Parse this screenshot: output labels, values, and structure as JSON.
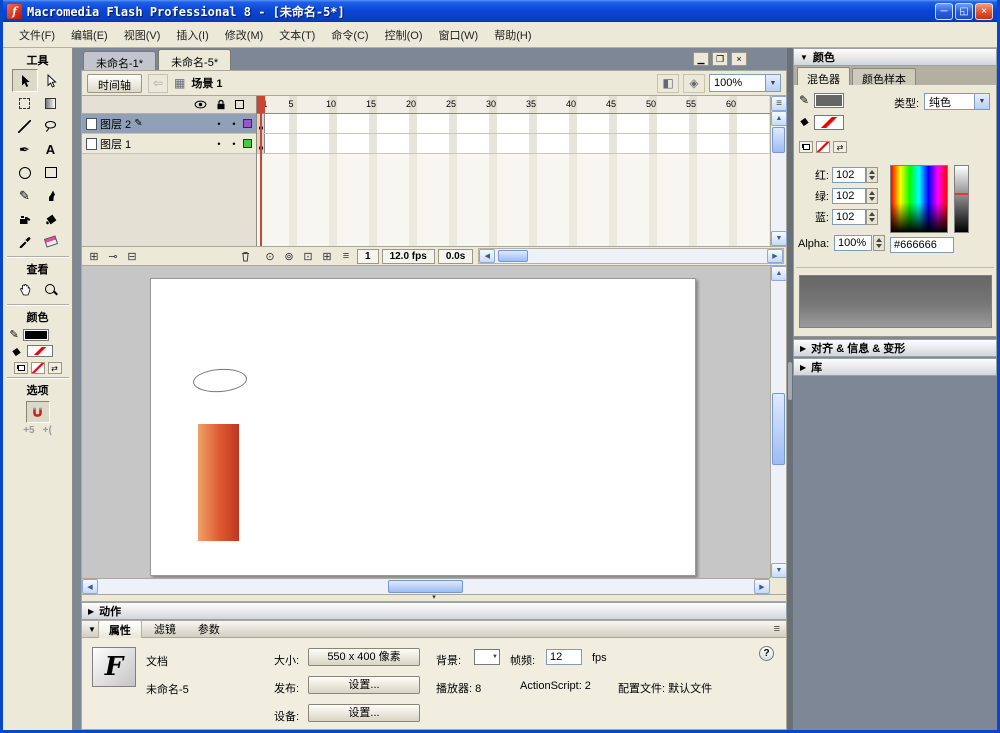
{
  "titlebar": {
    "title": "Macromedia Flash Professional 8 - [未命名-5*]"
  },
  "menu": {
    "items": [
      "文件(F)",
      "编辑(E)",
      "视图(V)",
      "插入(I)",
      "修改(M)",
      "文本(T)",
      "命令(C)",
      "控制(O)",
      "窗口(W)",
      "帮助(H)"
    ]
  },
  "toolbox": {
    "tools_label": "工具",
    "view_label": "查看",
    "colors_label": "颜色",
    "options_label": "选项"
  },
  "doc_tabs": [
    {
      "label": "未命名-1*",
      "active": false
    },
    {
      "label": "未命名-5*",
      "active": true
    }
  ],
  "timeline": {
    "panel_button": "时间轴",
    "scene_name": "场景 1",
    "zoom_value": "100%",
    "layers": [
      {
        "name": "图层 2",
        "selected": true,
        "outline_color": "#9954cc"
      },
      {
        "name": "图层 1",
        "selected": false,
        "outline_color": "#45cc45"
      }
    ],
    "ruler_numbers": [
      1,
      5,
      10,
      15,
      20,
      25,
      30,
      35,
      40,
      45,
      50,
      55,
      60
    ],
    "current_frame": "1",
    "frame_rate": "12.0 fps",
    "elapsed_time": "0.0s"
  },
  "stage": {
    "shape_gradient": [
      "#f0a068",
      "#dd5830",
      "#bf3620"
    ]
  },
  "actions_panel": {
    "title": "动作"
  },
  "properties": {
    "tabs": [
      "属性",
      "滤镜",
      "参数"
    ],
    "doc_type_label": "文档",
    "doc_name": "未命名-5",
    "size_label": "大小:",
    "size_button": "550 x 400 像素",
    "background_label": "背景:",
    "framerate_label": "帧频:",
    "framerate_value": "12",
    "framerate_unit": "fps",
    "publish_label": "发布:",
    "publish_button": "设置...",
    "player_text": "播放器: 8",
    "actionscript_text": "ActionScript: 2",
    "profile_text": "配置文件: 默认文件",
    "device_label": "设备:",
    "device_button": "设置..."
  },
  "color_panel": {
    "header": "颜色",
    "tabs": [
      "混色器",
      "颜色样本"
    ],
    "type_label": "类型:",
    "type_value": "纯色",
    "channels": [
      {
        "label": "红:",
        "value": "102"
      },
      {
        "label": "绿:",
        "value": "102"
      },
      {
        "label": "蓝:",
        "value": "102"
      }
    ],
    "alpha_label": "Alpha:",
    "alpha_value": "100%",
    "hex_value": "#666666",
    "current_color": "#666666"
  },
  "right_panels": {
    "align_header": "对齐 & 信息 & 变形",
    "library_header": "库"
  }
}
